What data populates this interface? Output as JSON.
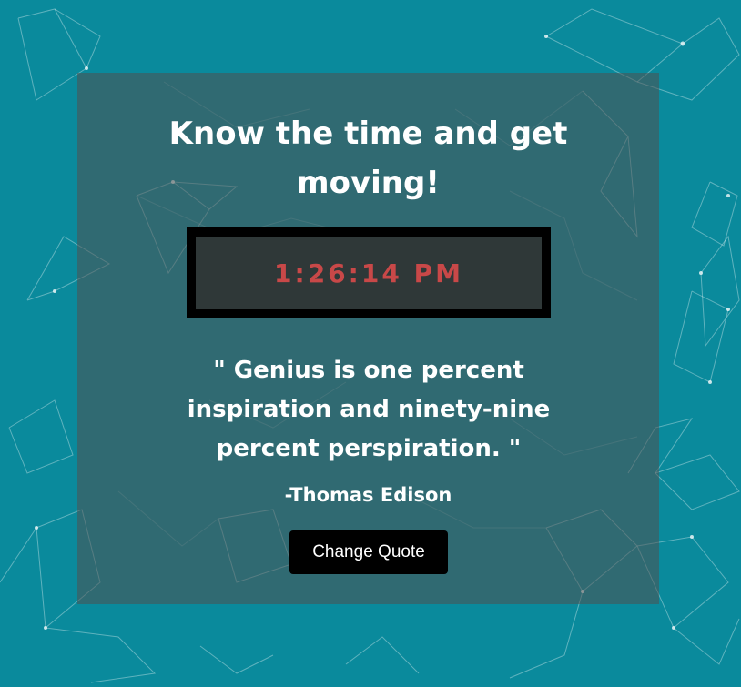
{
  "headline": "Know the time and get moving!",
  "clock": {
    "time": "1:26:14 PM"
  },
  "quote": {
    "text": "\" Genius is one percent inspiration and ninety-nine percent perspiration. \"",
    "author": "-Thomas Edison"
  },
  "button": {
    "label": "Change Quote"
  },
  "colors": {
    "background": "#0a8a9c",
    "card": "rgba(80,80,80,0.55)",
    "clock_digits": "#c84848",
    "button": "#000000"
  }
}
